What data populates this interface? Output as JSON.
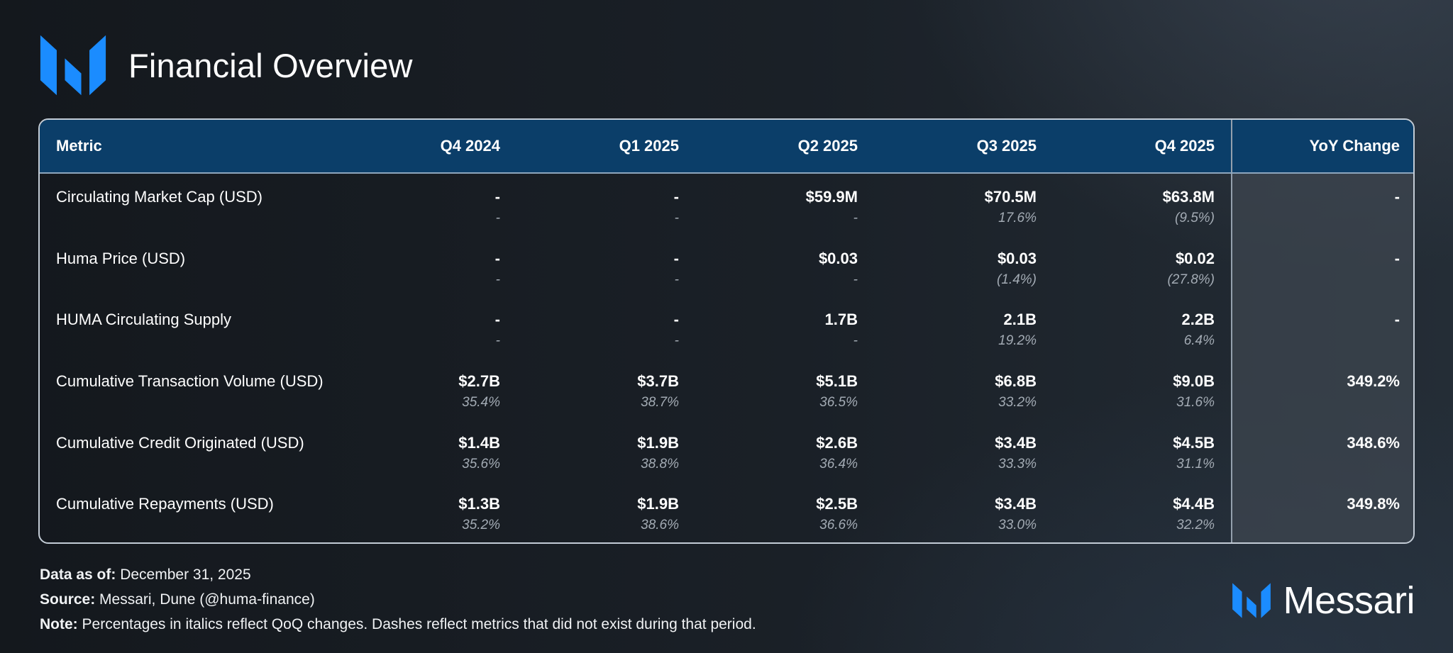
{
  "header": {
    "title": "Financial Overview",
    "logo_icon": "messari-m-logo-icon",
    "logo_color": "#1b8cff"
  },
  "chart_data": {
    "type": "table",
    "columns": [
      "Metric",
      "Q4 2024",
      "Q1 2025",
      "Q2 2025",
      "Q3 2025",
      "Q4 2025",
      "YoY Change"
    ],
    "rows": [
      {
        "metric": "Circulating Market Cap (USD)",
        "values": [
          "-",
          "-",
          "$59.9M",
          "$70.5M",
          "$63.8M"
        ],
        "changes": [
          "-",
          "-",
          "-",
          "17.6%",
          "(9.5%)"
        ],
        "yoy": "-"
      },
      {
        "metric": "Huma Price (USD)",
        "values": [
          "-",
          "-",
          "$0.03",
          "$0.03",
          "$0.02"
        ],
        "changes": [
          "-",
          "-",
          "-",
          "(1.4%)",
          "(27.8%)"
        ],
        "yoy": "-"
      },
      {
        "metric": "HUMA Circulating Supply",
        "values": [
          "-",
          "-",
          "1.7B",
          "2.1B",
          "2.2B"
        ],
        "changes": [
          "-",
          "-",
          "-",
          "19.2%",
          "6.4%"
        ],
        "yoy": "-"
      },
      {
        "metric": "Cumulative Transaction Volume (USD)",
        "values": [
          "$2.7B",
          "$3.7B",
          "$5.1B",
          "$6.8B",
          "$9.0B"
        ],
        "changes": [
          "35.4%",
          "38.7%",
          "36.5%",
          "33.2%",
          "31.6%"
        ],
        "yoy": "349.2%"
      },
      {
        "metric": "Cumulative Credit Originated (USD)",
        "values": [
          "$1.4B",
          "$1.9B",
          "$2.6B",
          "$3.4B",
          "$4.5B"
        ],
        "changes": [
          "35.6%",
          "38.8%",
          "36.4%",
          "33.3%",
          "31.1%"
        ],
        "yoy": "348.6%"
      },
      {
        "metric": "Cumulative Repayments (USD)",
        "values": [
          "$1.3B",
          "$1.9B",
          "$2.5B",
          "$3.4B",
          "$4.4B"
        ],
        "changes": [
          "35.2%",
          "38.6%",
          "36.6%",
          "33.0%",
          "32.2%"
        ],
        "yoy": "349.8%"
      }
    ],
    "header_color": "#0b3e69",
    "yoy_column_color": "#3e4650"
  },
  "footer": {
    "data_as_of_label": "Data as of:",
    "data_as_of": "December 31, 2025",
    "source_label": "Source:",
    "source": "Messari, Dune (@huma-finance)",
    "note_label": "Note:",
    "note": "Percentages in italics reflect QoQ changes. Dashes reflect metrics that did not exist during that period."
  },
  "brand": {
    "name": "Messari",
    "icon": "messari-m-logo-icon"
  }
}
